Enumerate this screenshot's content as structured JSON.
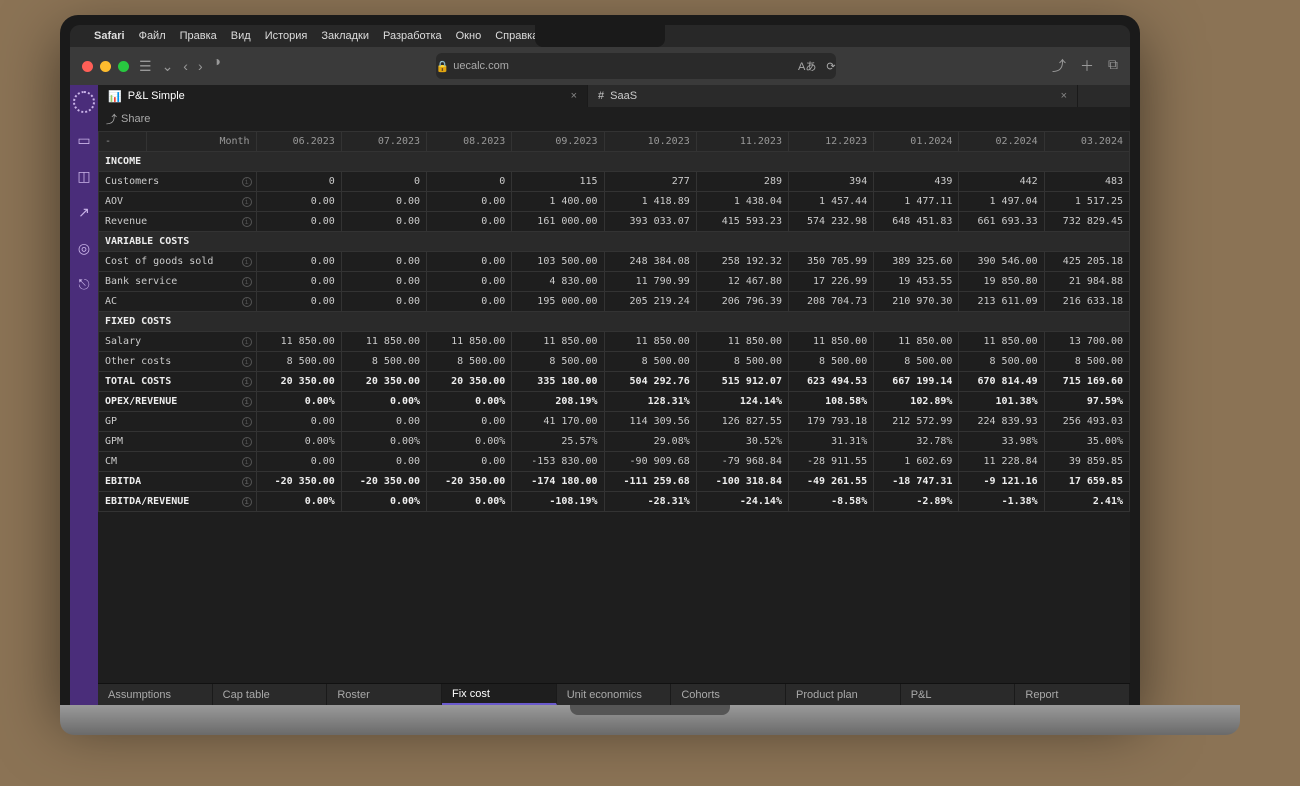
{
  "menubar": {
    "app": "Safari",
    "items": [
      "Файл",
      "Правка",
      "Вид",
      "История",
      "Закладки",
      "Разработка",
      "Окно",
      "Справка"
    ]
  },
  "address": "uecalc.com",
  "doc_tabs": [
    {
      "icon": "⇅",
      "label": "P&L Simple",
      "active": true
    },
    {
      "icon": "#",
      "label": "SaaS",
      "active": false
    }
  ],
  "share_label": "Share",
  "month_header": "Month",
  "dash": "-",
  "months": [
    "06.2023",
    "07.2023",
    "08.2023",
    "09.2023",
    "10.2023",
    "11.2023",
    "12.2023",
    "01.2024",
    "02.2024",
    "03.2024"
  ],
  "sections": {
    "income": "INCOME",
    "variable": "VARIABLE COSTS",
    "fixed": "FIXED COSTS"
  },
  "rows": [
    {
      "label": "Customers",
      "info": true,
      "vals": [
        "0",
        "0",
        "0",
        "115",
        "277",
        "289",
        "394",
        "439",
        "442",
        "483"
      ]
    },
    {
      "label": "AOV",
      "info": true,
      "vals": [
        "0.00",
        "0.00",
        "0.00",
        "1 400.00",
        "1 418.89",
        "1 438.04",
        "1 457.44",
        "1 477.11",
        "1 497.04",
        "1 517.25"
      ]
    },
    {
      "label": "Revenue",
      "info": true,
      "vals": [
        "0.00",
        "0.00",
        "0.00",
        "161 000.00",
        "393 033.07",
        "415 593.23",
        "574 232.98",
        "648 451.83",
        "661 693.33",
        "732 829.45"
      ]
    },
    {
      "label": "Cost of goods sold",
      "info": true,
      "vals": [
        "0.00",
        "0.00",
        "0.00",
        "103 500.00",
        "248 384.08",
        "258 192.32",
        "350 705.99",
        "389 325.60",
        "390 546.00",
        "425 205.18"
      ]
    },
    {
      "label": "Bank service",
      "info": true,
      "vals": [
        "0.00",
        "0.00",
        "0.00",
        "4 830.00",
        "11 790.99",
        "12 467.80",
        "17 226.99",
        "19 453.55",
        "19 850.80",
        "21 984.88"
      ]
    },
    {
      "label": "AC",
      "info": true,
      "vals": [
        "0.00",
        "0.00",
        "0.00",
        "195 000.00",
        "205 219.24",
        "206 796.39",
        "208 704.73",
        "210 970.30",
        "213 611.09",
        "216 633.18"
      ]
    },
    {
      "label": "Salary",
      "info": true,
      "vals": [
        "11 850.00",
        "11 850.00",
        "11 850.00",
        "11 850.00",
        "11 850.00",
        "11 850.00",
        "11 850.00",
        "11 850.00",
        "11 850.00",
        "13 700.00"
      ]
    },
    {
      "label": "Other costs",
      "info": true,
      "vals": [
        "8 500.00",
        "8 500.00",
        "8 500.00",
        "8 500.00",
        "8 500.00",
        "8 500.00",
        "8 500.00",
        "8 500.00",
        "8 500.00",
        "8 500.00"
      ]
    },
    {
      "label": "TOTAL COSTS",
      "info": true,
      "bold": true,
      "vals": [
        "20 350.00",
        "20 350.00",
        "20 350.00",
        "335 180.00",
        "504 292.76",
        "515 912.07",
        "623 494.53",
        "667 199.14",
        "670 814.49",
        "715 169.60"
      ]
    },
    {
      "label": "OPEX/REVENUE",
      "info": true,
      "bold": true,
      "vals": [
        "0.00%",
        "0.00%",
        "0.00%",
        "208.19%",
        "128.31%",
        "124.14%",
        "108.58%",
        "102.89%",
        "101.38%",
        "97.59%"
      ]
    },
    {
      "label": "GP",
      "info": true,
      "vals": [
        "0.00",
        "0.00",
        "0.00",
        "41 170.00",
        "114 309.56",
        "126 827.55",
        "179 793.18",
        "212 572.99",
        "224 839.93",
        "256 493.03"
      ]
    },
    {
      "label": "GPM",
      "info": true,
      "vals": [
        "0.00%",
        "0.00%",
        "0.00%",
        "25.57%",
        "29.08%",
        "30.52%",
        "31.31%",
        "32.78%",
        "33.98%",
        "35.00%"
      ]
    },
    {
      "label": "CM",
      "info": true,
      "vals": [
        "0.00",
        "0.00",
        "0.00",
        "-153 830.00",
        "-90 909.68",
        "-79 968.84",
        "-28 911.55",
        "1 602.69",
        "11 228.84",
        "39 859.85"
      ]
    },
    {
      "label": "EBITDA",
      "info": true,
      "bold": true,
      "vals": [
        "-20 350.00",
        "-20 350.00",
        "-20 350.00",
        "-174 180.00",
        "-111 259.68",
        "-100 318.84",
        "-49 261.55",
        "-18 747.31",
        "-9 121.16",
        "17 659.85"
      ]
    },
    {
      "label": "EBITDA/REVENUE",
      "info": true,
      "bold": true,
      "vals": [
        "0.00%",
        "0.00%",
        "0.00%",
        "-108.19%",
        "-28.31%",
        "-24.14%",
        "-8.58%",
        "-2.89%",
        "-1.38%",
        "2.41%"
      ]
    }
  ],
  "bottom_tabs": [
    {
      "label": "Assumptions"
    },
    {
      "label": "Cap table"
    },
    {
      "label": "Roster"
    },
    {
      "label": "Fix cost",
      "active": true
    },
    {
      "label": "Unit economics"
    },
    {
      "label": "Cohorts"
    },
    {
      "label": "Product plan"
    },
    {
      "label": "P&L"
    },
    {
      "label": "Report"
    }
  ]
}
